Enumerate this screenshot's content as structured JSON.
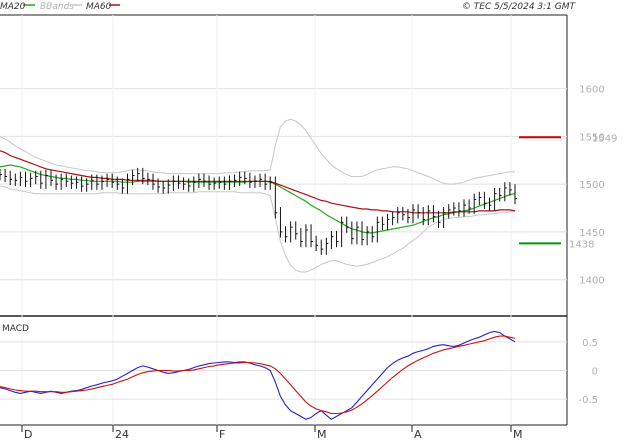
{
  "header": {
    "legend": [
      {
        "label": "MA20",
        "color": "#22aa22"
      },
      {
        "label": "BBands",
        "color": "#c8c8c8"
      },
      {
        "label": "MA60",
        "color": "#aa1111"
      }
    ],
    "copyright": "© TEC 5/5/2024 3:1 GMT"
  },
  "chart_data": [
    {
      "type": "line",
      "title": "",
      "y_ticks": [
        1400,
        1450,
        1500,
        1550,
        1600
      ],
      "y_tick_labels": [
        "1400",
        "1450",
        "1500",
        "1550",
        "1600"
      ],
      "ylim": [
        1362,
        1677
      ],
      "x_ticks": [
        "D",
        "24",
        "F",
        "M",
        "A",
        "M"
      ],
      "grid": true,
      "levels": [
        {
          "label": "1549",
          "value": 1549,
          "color": "#cc0000"
        },
        {
          "label": "1438",
          "value": 1438,
          "color": "#009900"
        }
      ],
      "series": [
        {
          "name": "Price",
          "color": "#000000",
          "values": [
            1510,
            1508,
            1505,
            1504,
            1507,
            1503,
            1506,
            1508,
            1501,
            1509,
            1504,
            1500,
            1505,
            1503,
            1501,
            1502,
            1498,
            1500,
            1504,
            1500,
            1503,
            1505,
            1502,
            1500,
            1496,
            1505,
            1509,
            1511,
            1506,
            1505,
            1500,
            1497,
            1496,
            1499,
            1503,
            1501,
            1500,
            1498,
            1502,
            1505,
            1503,
            1500,
            1501,
            1502,
            1500,
            1503,
            1504,
            1507,
            1506,
            1502,
            1503,
            1505,
            1500,
            1502,
            1470,
            1450,
            1445,
            1455,
            1448,
            1440,
            1452,
            1440,
            1436,
            1432,
            1438,
            1445,
            1440,
            1460,
            1455,
            1443,
            1455,
            1442,
            1450,
            1445,
            1460,
            1458,
            1463,
            1465,
            1470,
            1468,
            1465,
            1473,
            1470,
            1463,
            1472,
            1466,
            1460,
            1470,
            1473,
            1475,
            1472,
            1478,
            1475,
            1484,
            1486,
            1480,
            1478,
            1490,
            1488,
            1496,
            1494,
            1485
          ]
        },
        {
          "name": "MA20",
          "color": "#22aa22",
          "values": [
            1518,
            1519,
            1520,
            1519,
            1518,
            1516,
            1514,
            1512,
            1510,
            1509,
            1508,
            1507,
            1506,
            1506,
            1505,
            1505,
            1504,
            1504,
            1503,
            1503,
            1503,
            1503,
            1503,
            1503,
            1502,
            1502,
            1502,
            1503,
            1503,
            1503,
            1503,
            1503,
            1503,
            1503,
            1503,
            1503,
            1503,
            1502,
            1502,
            1502,
            1502,
            1502,
            1502,
            1502,
            1502,
            1502,
            1502,
            1502,
            1502,
            1503,
            1503,
            1503,
            1503,
            1502,
            1500,
            1497,
            1494,
            1491,
            1488,
            1485,
            1482,
            1478,
            1475,
            1472,
            1468,
            1465,
            1462,
            1459,
            1456,
            1453,
            1452,
            1450,
            1449,
            1449,
            1450,
            1451,
            1452,
            1453,
            1454,
            1455,
            1456,
            1457,
            1459,
            1461,
            1463,
            1465,
            1466,
            1468,
            1469,
            1470,
            1471,
            1472,
            1473,
            1475,
            1477,
            1479,
            1481,
            1483,
            1485,
            1487,
            1489,
            1490
          ]
        },
        {
          "name": "BBands upper",
          "color": "#c8c8c8",
          "values": [
            1550,
            1547,
            1544,
            1540,
            1537,
            1534,
            1531,
            1528,
            1526,
            1524,
            1522,
            1520,
            1519,
            1518,
            1517,
            1516,
            1515,
            1514,
            1514,
            1513,
            1512,
            1512,
            1512,
            1512,
            1513,
            1514,
            1515,
            1515,
            1514,
            1514,
            1513,
            1512,
            1512,
            1511,
            1511,
            1511,
            1511,
            1511,
            1511,
            1511,
            1511,
            1511,
            1511,
            1511,
            1512,
            1512,
            1512,
            1513,
            1513,
            1514,
            1514,
            1514,
            1514,
            1515,
            1540,
            1560,
            1566,
            1568,
            1566,
            1562,
            1556,
            1548,
            1540,
            1532,
            1526,
            1520,
            1516,
            1513,
            1510,
            1508,
            1508,
            1508,
            1510,
            1513,
            1515,
            1516,
            1517,
            1518,
            1518,
            1517,
            1516,
            1514,
            1512,
            1510,
            1508,
            1506,
            1503,
            1501,
            1500,
            1500,
            1501,
            1502,
            1504,
            1506,
            1507,
            1508,
            1509,
            1510,
            1511,
            1512,
            1513,
            1513
          ]
        },
        {
          "name": "BBands lower",
          "color": "#c8c8c8",
          "values": [
            1498,
            1497,
            1495,
            1494,
            1493,
            1492,
            1491,
            1490,
            1490,
            1490,
            1490,
            1490,
            1490,
            1490,
            1490,
            1490,
            1490,
            1490,
            1490,
            1490,
            1491,
            1491,
            1491,
            1491,
            1490,
            1490,
            1490,
            1490,
            1490,
            1490,
            1490,
            1490,
            1490,
            1491,
            1491,
            1491,
            1491,
            1491,
            1491,
            1492,
            1492,
            1492,
            1492,
            1492,
            1492,
            1492,
            1492,
            1491,
            1491,
            1491,
            1491,
            1491,
            1490,
            1488,
            1465,
            1440,
            1425,
            1415,
            1410,
            1408,
            1408,
            1410,
            1413,
            1416,
            1418,
            1420,
            1420,
            1418,
            1416,
            1415,
            1414,
            1415,
            1416,
            1418,
            1420,
            1422,
            1424,
            1427,
            1430,
            1433,
            1437,
            1441,
            1445,
            1450,
            1455,
            1458,
            1461,
            1463,
            1464,
            1465,
            1465,
            1466,
            1466,
            1467,
            1468,
            1468,
            1469,
            1469,
            1470,
            1470,
            1471,
            1472
          ]
        },
        {
          "name": "MA60",
          "color": "#aa1111",
          "values": [
            1535,
            1533,
            1530,
            1528,
            1526,
            1524,
            1522,
            1520,
            1518,
            1516,
            1515,
            1514,
            1513,
            1512,
            1511,
            1510,
            1509,
            1508,
            1507,
            1507,
            1506,
            1506,
            1505,
            1505,
            1505,
            1504,
            1504,
            1504,
            1504,
            1504,
            1504,
            1503,
            1503,
            1503,
            1503,
            1503,
            1503,
            1503,
            1503,
            1503,
            1503,
            1503,
            1503,
            1503,
            1503,
            1503,
            1503,
            1503,
            1503,
            1503,
            1503,
            1503,
            1503,
            1503,
            1501,
            1499,
            1497,
            1495,
            1493,
            1491,
            1489,
            1487,
            1485,
            1483,
            1482,
            1480,
            1479,
            1478,
            1477,
            1476,
            1475,
            1474,
            1474,
            1473,
            1473,
            1472,
            1472,
            1471,
            1471,
            1471,
            1471,
            1470,
            1470,
            1470,
            1470,
            1470,
            1470,
            1470,
            1470,
            1471,
            1471,
            1471,
            1471,
            1471,
            1472,
            1472,
            1472,
            1472,
            1473,
            1473,
            1473,
            1472
          ]
        }
      ]
    },
    {
      "type": "line",
      "title": "MACD",
      "y_ticks": [
        0.5,
        0,
        -0.5
      ],
      "y_tick_labels": [
        "0.5",
        "0",
        "-0.5"
      ],
      "ylim": [
        -0.95,
        0.95
      ],
      "grid": true,
      "series": [
        {
          "name": "MACD",
          "color": "#2222cc",
          "values": [
            -0.3,
            -0.32,
            -0.35,
            -0.38,
            -0.4,
            -0.38,
            -0.36,
            -0.38,
            -0.4,
            -0.38,
            -0.36,
            -0.38,
            -0.4,
            -0.38,
            -0.36,
            -0.35,
            -0.33,
            -0.3,
            -0.27,
            -0.25,
            -0.22,
            -0.2,
            -0.18,
            -0.15,
            -0.1,
            -0.05,
            0.0,
            0.05,
            0.08,
            0.06,
            0.03,
            0.0,
            -0.03,
            -0.05,
            -0.04,
            -0.02,
            0.0,
            0.02,
            0.05,
            0.08,
            0.1,
            0.12,
            0.13,
            0.14,
            0.15,
            0.15,
            0.14,
            0.15,
            0.15,
            0.13,
            0.1,
            0.08,
            0.05,
            0.0,
            -0.2,
            -0.45,
            -0.6,
            -0.7,
            -0.75,
            -0.8,
            -0.85,
            -0.82,
            -0.75,
            -0.7,
            -0.78,
            -0.85,
            -0.8,
            -0.75,
            -0.7,
            -0.65,
            -0.55,
            -0.45,
            -0.35,
            -0.25,
            -0.15,
            -0.05,
            0.05,
            0.12,
            0.18,
            0.22,
            0.25,
            0.3,
            0.33,
            0.35,
            0.38,
            0.42,
            0.44,
            0.45,
            0.43,
            0.42,
            0.44,
            0.48,
            0.52,
            0.55,
            0.58,
            0.62,
            0.66,
            0.68,
            0.66,
            0.6,
            0.55,
            0.5
          ]
        },
        {
          "name": "Signal",
          "color": "#cc1111",
          "values": [
            -0.28,
            -0.3,
            -0.32,
            -0.34,
            -0.35,
            -0.36,
            -0.36,
            -0.36,
            -0.37,
            -0.37,
            -0.37,
            -0.37,
            -0.38,
            -0.38,
            -0.37,
            -0.36,
            -0.35,
            -0.34,
            -0.32,
            -0.3,
            -0.28,
            -0.26,
            -0.24,
            -0.21,
            -0.18,
            -0.15,
            -0.11,
            -0.07,
            -0.04,
            -0.02,
            -0.01,
            0.0,
            0.0,
            0.0,
            -0.01,
            -0.01,
            0.0,
            0.0,
            0.01,
            0.03,
            0.05,
            0.07,
            0.08,
            0.1,
            0.11,
            0.12,
            0.13,
            0.13,
            0.14,
            0.14,
            0.13,
            0.12,
            0.1,
            0.08,
            0.03,
            -0.05,
            -0.15,
            -0.25,
            -0.35,
            -0.45,
            -0.55,
            -0.62,
            -0.67,
            -0.7,
            -0.72,
            -0.75,
            -0.75,
            -0.74,
            -0.72,
            -0.69,
            -0.64,
            -0.58,
            -0.51,
            -0.44,
            -0.36,
            -0.28,
            -0.2,
            -0.12,
            -0.05,
            0.02,
            0.08,
            0.13,
            0.18,
            0.22,
            0.26,
            0.3,
            0.33,
            0.36,
            0.38,
            0.4,
            0.42,
            0.44,
            0.46,
            0.48,
            0.5,
            0.52,
            0.55,
            0.58,
            0.6,
            0.6,
            0.58,
            0.56
          ]
        }
      ]
    }
  ]
}
